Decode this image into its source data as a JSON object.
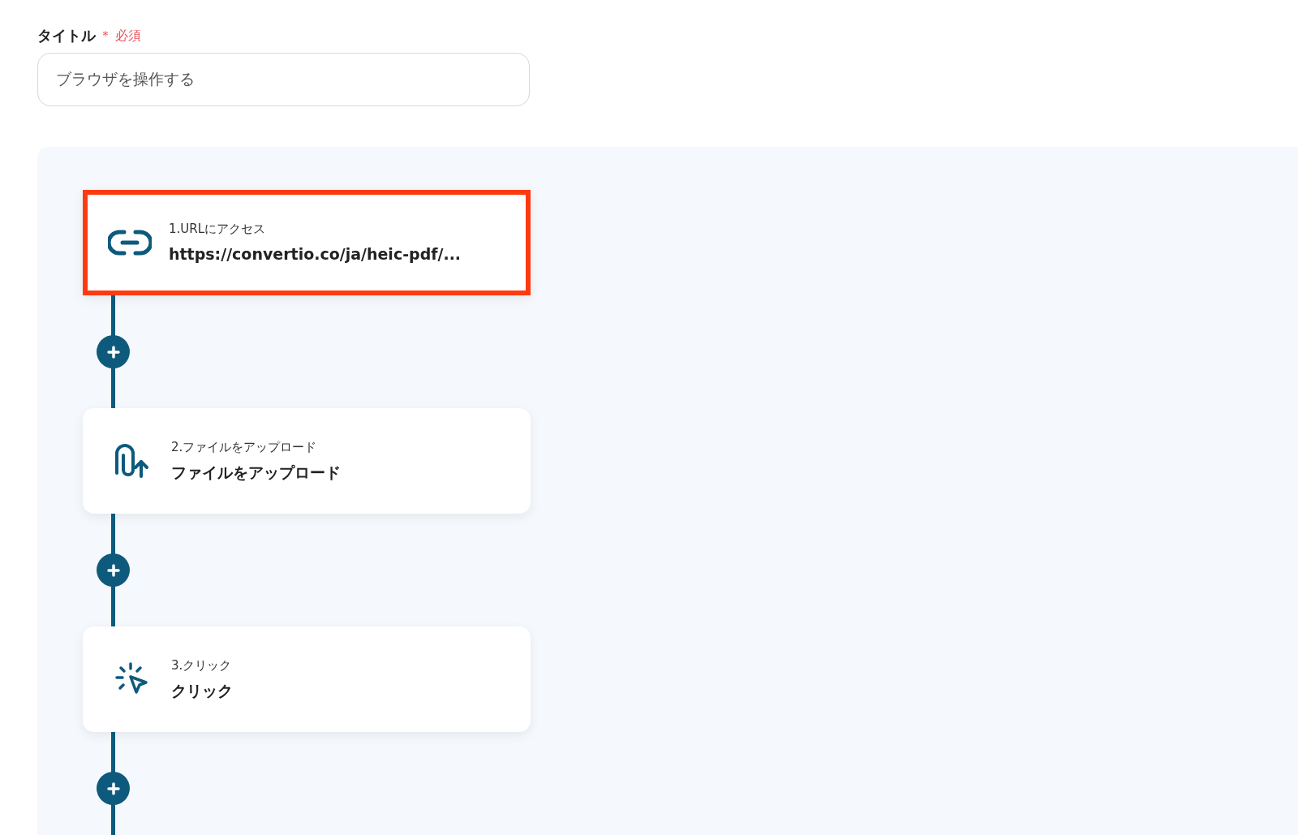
{
  "title_field": {
    "label": "タイトル",
    "required_mark": "＊",
    "required_text": "必須",
    "value": "ブラウザを操作する"
  },
  "steps": [
    {
      "kind": "url",
      "caption": "1.URLにアクセス",
      "title": "https://convertio.co/ja/heic-pdf/...",
      "selected": true
    },
    {
      "kind": "upload",
      "caption": "2.ファイルをアップロード",
      "title": "ファイルをアップロード",
      "selected": false
    },
    {
      "kind": "click",
      "caption": "3.クリック",
      "title": "クリック",
      "selected": false
    }
  ]
}
